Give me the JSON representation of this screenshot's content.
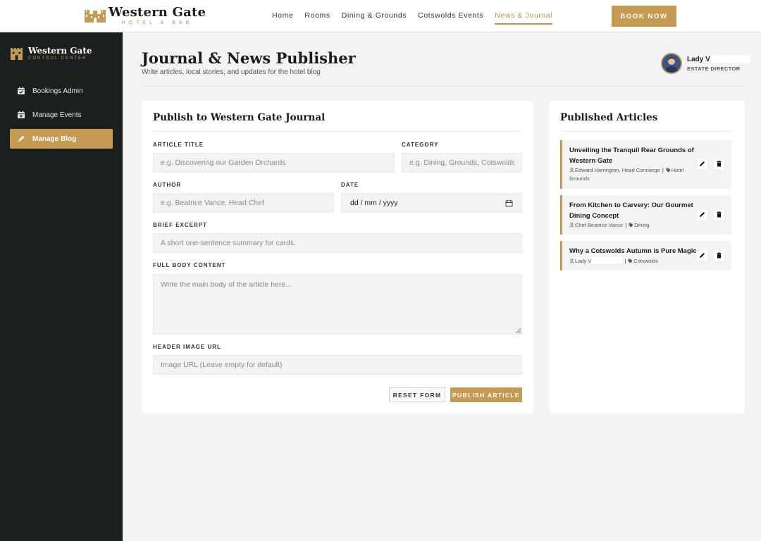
{
  "topnav": {
    "brand_name": "Western Gate",
    "brand_sub": "HOTEL & B&B",
    "links": [
      "Home",
      "Rooms",
      "Dining & Grounds",
      "Cotswolds Events",
      "News & Journal"
    ],
    "active_link": "News & Journal",
    "book_label": "BOOK NOW"
  },
  "sidebar": {
    "brand_name": "Western Gate",
    "brand_sub": "CONTROL CENTER",
    "items": [
      {
        "label": "Bookings Admin",
        "icon": "calendar-check-icon"
      },
      {
        "label": "Manage Events",
        "icon": "calendar-plus-icon"
      },
      {
        "label": "Manage Blog",
        "icon": "pen-icon"
      }
    ],
    "active_item": "Manage Blog"
  },
  "header": {
    "title": "Journal & News Publisher",
    "subtitle": "Write articles, local stories, and updates for the hotel blog",
    "user_name": "Lady V",
    "user_role": "ESTATE DIRECTOR"
  },
  "form": {
    "title": "Publish to Western Gate Journal",
    "article_title_label": "ARTICLE TITLE",
    "article_title_placeholder": "e.g. Discovering our Garden Orchards",
    "category_label": "CATEGORY",
    "category_placeholder": "e.g. Dining, Grounds, Cotswolds",
    "author_label": "AUTHOR",
    "author_placeholder": "e.g. Beatrice Vance, Head Chef",
    "date_label": "DATE",
    "date_placeholder": "dd / mm / yyyy",
    "excerpt_label": "BRIEF EXCERPT",
    "excerpt_placeholder": "A short one-sentence summary for cards.",
    "body_label": "FULL BODY CONTENT",
    "body_placeholder": "Write the main body of the article here...",
    "image_label": "HEADER IMAGE URL",
    "image_placeholder": "Image URL (Leave empty for default)",
    "reset_label": "RESET FORM",
    "publish_label": "PUBLISH ARTICLE"
  },
  "articles": {
    "title": "Published Articles",
    "items": [
      {
        "title": "Unveiling the Tranquil Rear Grounds of Western Gate",
        "author": "Edward Harrington, Head Concierge",
        "category": "Hotel Grounds"
      },
      {
        "title": "From Kitchen to Carvery: Our Gourmet Dining Concept",
        "author": "Chef Beatrice Vance",
        "category": "Dining"
      },
      {
        "title": "Why a Cotswolds Autumn is Pure Magic",
        "author": "Lady V",
        "category": "Cotswolds"
      }
    ]
  },
  "colors": {
    "accent": "#c59a52",
    "sidebar_bg": "#1c1f20",
    "page_bg": "#f3f3f3"
  }
}
